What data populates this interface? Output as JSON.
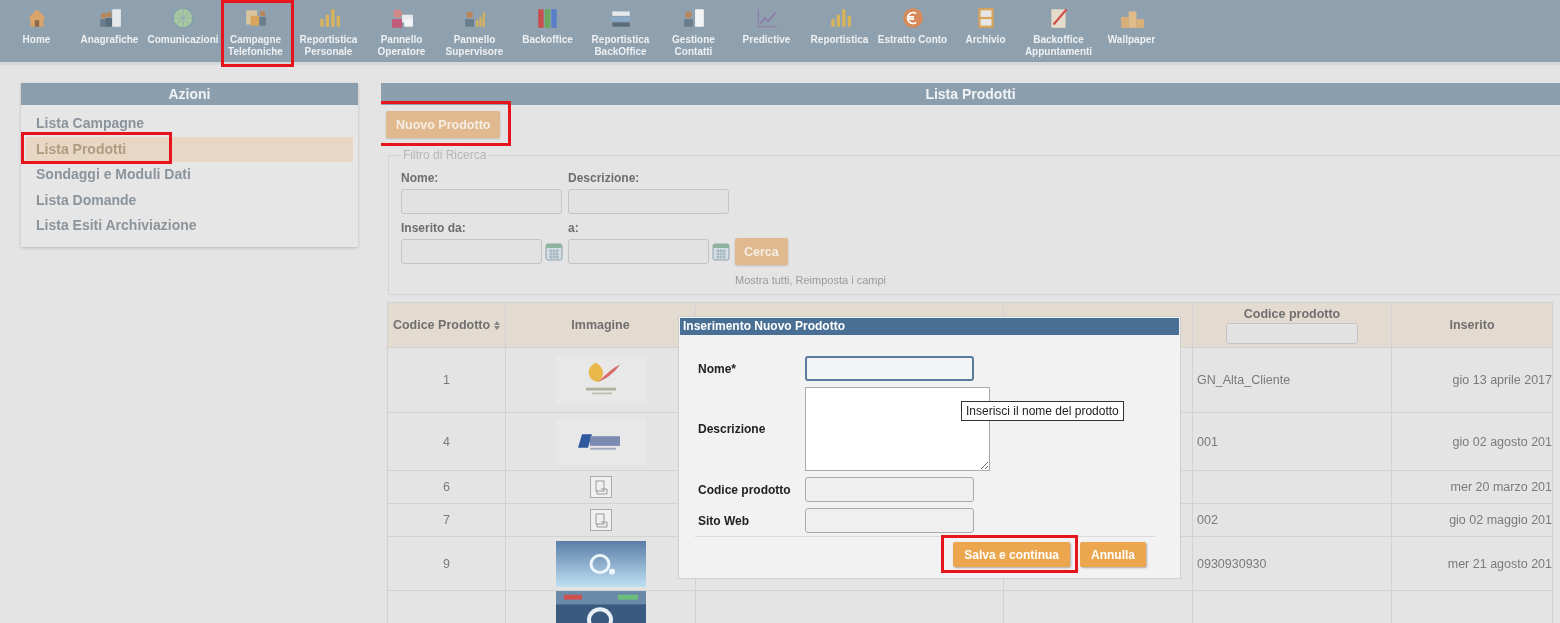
{
  "nav": [
    {
      "label": "Home",
      "highlighted": false
    },
    {
      "label": "Anagrafiche",
      "highlighted": false
    },
    {
      "label": "Comunicazioni",
      "highlighted": false
    },
    {
      "label": "Campagne Telefoniche",
      "highlighted": true
    },
    {
      "label": "Reportistica Personale",
      "highlighted": false
    },
    {
      "label": "Pannello Operatore",
      "highlighted": false
    },
    {
      "label": "Pannello Supervisore",
      "highlighted": false
    },
    {
      "label": "Backoffice",
      "highlighted": false
    },
    {
      "label": "Reportistica BackOffice",
      "highlighted": false
    },
    {
      "label": "Gestione Contatti",
      "highlighted": false
    },
    {
      "label": "Predictive",
      "highlighted": false
    },
    {
      "label": "Reportistica",
      "highlighted": false
    },
    {
      "label": "Estratto Conto",
      "highlighted": false
    },
    {
      "label": "Archivio",
      "highlighted": false
    },
    {
      "label": "Backoffice Appuntamenti",
      "highlighted": false
    },
    {
      "label": "Wallpaper",
      "highlighted": false
    }
  ],
  "sidebar": {
    "title": "Azioni",
    "items": [
      {
        "label": "Lista Campagne",
        "selected": false,
        "highlighted": false
      },
      {
        "label": "Lista Prodotti",
        "selected": true,
        "highlighted": true
      },
      {
        "label": "Sondaggi e Moduli Dati",
        "selected": false,
        "highlighted": false
      },
      {
        "label": "Lista Domande",
        "selected": false,
        "highlighted": false
      },
      {
        "label": "Lista Esiti Archiviazione",
        "selected": false,
        "highlighted": false
      }
    ]
  },
  "panel": {
    "title": "Lista Prodotti",
    "new_button": {
      "label": "Nuovo Prodotto",
      "highlighted": true
    },
    "filter": {
      "legend": "Filtro di Ricerca",
      "name_label": "Nome:",
      "description_label": "Descrizione:",
      "from_label": "Inserito da:",
      "to_label": "a:",
      "search_button": "Cerca",
      "show_all_link": "Mostra tutti",
      "separator": ",",
      "reset_link": "Reimposta i campi"
    },
    "table": {
      "columns": [
        {
          "label": "Codice Prodotto",
          "kind": "sortable"
        },
        {
          "label": "Immagine",
          "kind": "plain"
        },
        {
          "kind": "plain"
        },
        {
          "kind": "plain"
        },
        {
          "label": "Codice prodotto",
          "kind": "filter"
        },
        {
          "label": "Inserito",
          "kind": "plain"
        }
      ],
      "rows": [
        {
          "code": "1",
          "kind": "logo",
          "product_code": "GN_Alta_Cliente",
          "inserted": "gio 13 aprile 2017"
        },
        {
          "code": "4",
          "kind": "logo",
          "product_code": "001",
          "inserted": "gio 02 agosto 201"
        },
        {
          "code": "6",
          "kind": "placeholder",
          "inserted": "mer 20 marzo 201"
        },
        {
          "code": "7",
          "kind": "placeholder",
          "product_code": "002",
          "inserted": "gio 02 maggio 201"
        },
        {
          "code": "9",
          "kind": "logo",
          "product_code": "0930930930",
          "inserted": "mer 21 agosto 201"
        },
        {
          "kind": "logo"
        }
      ]
    }
  },
  "dialog": {
    "title": "Inserimento Nuovo Prodotto",
    "fields": [
      {
        "label": "Nome*",
        "kind": "input",
        "focused": true
      },
      {
        "label": "Descrizione",
        "kind": "textarea",
        "focused": false
      },
      {
        "label": "Codice prodotto",
        "kind": "input",
        "focused": false
      },
      {
        "label": "Sito Web",
        "kind": "input",
        "focused": false
      }
    ],
    "tooltip": "Inserisci il nome del prodotto",
    "buttons": [
      {
        "label": "Salva e continua",
        "highlighted": true
      },
      {
        "label": "Annulla",
        "highlighted": false
      }
    ]
  }
}
